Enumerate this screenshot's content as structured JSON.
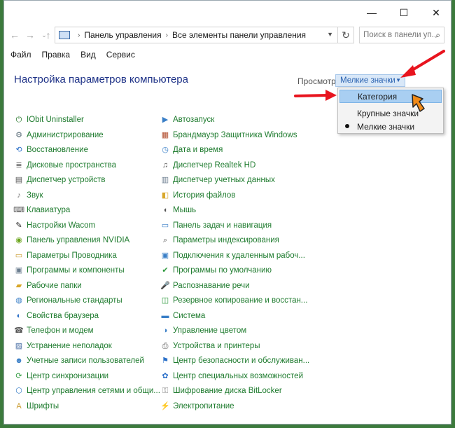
{
  "window": {
    "controls": [
      "—",
      "☐",
      "✕"
    ]
  },
  "nav": {
    "back": "←",
    "forward": "→",
    "up": "↑",
    "history": "⌄",
    "breadcrumbs": [
      "Панель управления",
      "Все элементы панели управления"
    ],
    "refresh": "↻",
    "search_placeholder": "Поиск в панели уп..."
  },
  "menu": {
    "items": [
      "Файл",
      "Правка",
      "Вид",
      "Сервис"
    ]
  },
  "header": {
    "title": "Настройка параметров компьютера",
    "view_label": "Просмотр:",
    "view_value": "Мелкие значки"
  },
  "view_dropdown": {
    "options": [
      {
        "label": "Категория",
        "highlighted": true,
        "selected": false
      },
      {
        "label": "Крупные значки",
        "highlighted": false,
        "selected": false
      },
      {
        "label": "Мелкие значки",
        "highlighted": false,
        "selected": true
      }
    ]
  },
  "colors": {
    "link": "#1e7b2e",
    "heading": "#1e3287",
    "arrow": "#e8141e",
    "highlight": "#a9cff2"
  },
  "items_left": [
    {
      "label": "IObit Uninstaller",
      "icon": "iobit-icon",
      "glyph": "⏻",
      "color": "#2e7d32"
    },
    {
      "label": "Администрирование",
      "icon": "admin-tools-icon",
      "glyph": "⚙",
      "color": "#5b6e7a"
    },
    {
      "label": "Восстановление",
      "icon": "recovery-icon",
      "glyph": "⟲",
      "color": "#2b70c9"
    },
    {
      "label": "Дисковые пространства",
      "icon": "storage-spaces-icon",
      "glyph": "≣",
      "color": "#666666"
    },
    {
      "label": "Диспетчер устройств",
      "icon": "device-manager-icon",
      "glyph": "▤",
      "color": "#555555"
    },
    {
      "label": "Звук",
      "icon": "sound-icon",
      "glyph": "♪",
      "color": "#777777"
    },
    {
      "label": "Клавиатура",
      "icon": "keyboard-icon",
      "glyph": "⌨",
      "color": "#555555"
    },
    {
      "label": "Настройки Wacom",
      "icon": "wacom-icon",
      "glyph": "✎",
      "color": "#222222"
    },
    {
      "label": "Панель управления NVIDIA",
      "icon": "nvidia-icon",
      "glyph": "◉",
      "color": "#6aa51c"
    },
    {
      "label": "Параметры Проводника",
      "icon": "explorer-options-icon",
      "glyph": "▭",
      "color": "#c99a2e"
    },
    {
      "label": "Программы и компоненты",
      "icon": "programs-icon",
      "glyph": "▣",
      "color": "#6b7d8f"
    },
    {
      "label": "Рабочие папки",
      "icon": "work-folders-icon",
      "glyph": "▰",
      "color": "#d8a72a"
    },
    {
      "label": "Региональные стандарты",
      "icon": "region-icon",
      "glyph": "◍",
      "color": "#3a7fc7"
    },
    {
      "label": "Свойства браузера",
      "icon": "internet-options-icon",
      "glyph": "◐",
      "color": "#2b70c9"
    },
    {
      "label": "Телефон и модем",
      "icon": "phone-modem-icon",
      "glyph": "☎",
      "color": "#555555"
    },
    {
      "label": "Устранение неполадок",
      "icon": "troubleshooting-icon",
      "glyph": "▨",
      "color": "#4a6fa5"
    },
    {
      "label": "Учетные записи пользователей",
      "icon": "user-accounts-icon",
      "glyph": "☻",
      "color": "#3a7fc7"
    },
    {
      "label": "Центр синхронизации",
      "icon": "sync-center-icon",
      "glyph": "⟳",
      "color": "#2e9a3e"
    },
    {
      "label": "Центр управления сетями и общи...",
      "icon": "network-center-icon",
      "glyph": "⬡",
      "color": "#3a7fc7"
    },
    {
      "label": "Шрифты",
      "icon": "fonts-icon",
      "glyph": "A",
      "color": "#c99a2e"
    }
  ],
  "items_right": [
    {
      "label": "Автозапуск",
      "icon": "autoplay-icon",
      "glyph": "▶",
      "color": "#3a7fc7"
    },
    {
      "label": "Брандмауэр Защитника Windows",
      "icon": "firewall-icon",
      "glyph": "▦",
      "color": "#b04a2a"
    },
    {
      "label": "Дата и время",
      "icon": "date-time-icon",
      "glyph": "◷",
      "color": "#3a7fc7"
    },
    {
      "label": "Диспетчер Realtek HD",
      "icon": "realtek-icon",
      "glyph": "♫",
      "color": "#555555"
    },
    {
      "label": "Диспетчер учетных данных",
      "icon": "credential-manager-icon",
      "glyph": "▥",
      "color": "#6b7d8f"
    },
    {
      "label": "История файлов",
      "icon": "file-history-icon",
      "glyph": "◧",
      "color": "#d8a72a"
    },
    {
      "label": "Мышь",
      "icon": "mouse-icon",
      "glyph": "◖",
      "color": "#555555"
    },
    {
      "label": "Панель задач и навигация",
      "icon": "taskbar-icon",
      "glyph": "▭",
      "color": "#3a7fc7"
    },
    {
      "label": "Параметры индексирования",
      "icon": "indexing-icon",
      "glyph": "⌕",
      "color": "#555555"
    },
    {
      "label": "Подключения к удаленным рабоч...",
      "icon": "remote-desktop-icon",
      "glyph": "▣",
      "color": "#3a7fc7"
    },
    {
      "label": "Программы по умолчанию",
      "icon": "default-programs-icon",
      "glyph": "✔",
      "color": "#2e9a3e"
    },
    {
      "label": "Распознавание речи",
      "icon": "speech-icon",
      "glyph": "🎤",
      "color": "#555555"
    },
    {
      "label": "Резервное копирование и восстан...",
      "icon": "backup-icon",
      "glyph": "◫",
      "color": "#2e9a3e"
    },
    {
      "label": "Система",
      "icon": "system-icon",
      "glyph": "▬",
      "color": "#3a7fc7"
    },
    {
      "label": "Управление цветом",
      "icon": "color-management-icon",
      "glyph": "◑",
      "color": "#3a7fc7"
    },
    {
      "label": "Устройства и принтеры",
      "icon": "devices-printers-icon",
      "glyph": "⎙",
      "color": "#555555"
    },
    {
      "label": "Центр безопасности и обслуживан...",
      "icon": "security-center-icon",
      "glyph": "⚑",
      "color": "#2b70c9"
    },
    {
      "label": "Центр специальных возможностей",
      "icon": "ease-of-access-icon",
      "glyph": "✿",
      "color": "#2b70c9"
    },
    {
      "label": "Шифрование диска BitLocker",
      "icon": "bitlocker-icon",
      "glyph": "⚿",
      "color": "#888888"
    },
    {
      "label": "Электропитание",
      "icon": "power-options-icon",
      "glyph": "⚡",
      "color": "#2e9a3e"
    }
  ]
}
